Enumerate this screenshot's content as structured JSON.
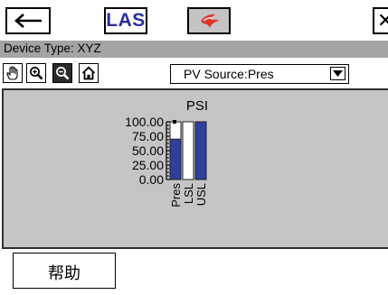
{
  "topbar": {
    "back_icon": "left-arrow-icon",
    "las_label": "LAS",
    "status_icon": "red-swirl-icon",
    "close_label": "✕"
  },
  "device": {
    "type_text": "Device Type: XYZ"
  },
  "toolbar": {
    "tools": [
      {
        "icon": "pan-hand-icon"
      },
      {
        "icon": "zoom-in-icon"
      },
      {
        "icon": "zoom-out-icon",
        "active": true
      },
      {
        "icon": "home-icon"
      }
    ],
    "pv_source_label": "PV Source:Pres",
    "dropdown_icon": "chevron-down-icon"
  },
  "chart_data": {
    "type": "bar",
    "title": "PSI",
    "categories": [
      "Pres",
      "LSL",
      "USL"
    ],
    "values": [
      70,
      0,
      100
    ],
    "ylim": [
      0,
      100
    ],
    "yticks": [
      "100.00",
      "75.00",
      "50.00",
      "25.00",
      "0.00"
    ],
    "bar_color": "#2f3fa0",
    "background_color": "#c5c5c5"
  },
  "bottom": {
    "help_label": "帮助"
  }
}
